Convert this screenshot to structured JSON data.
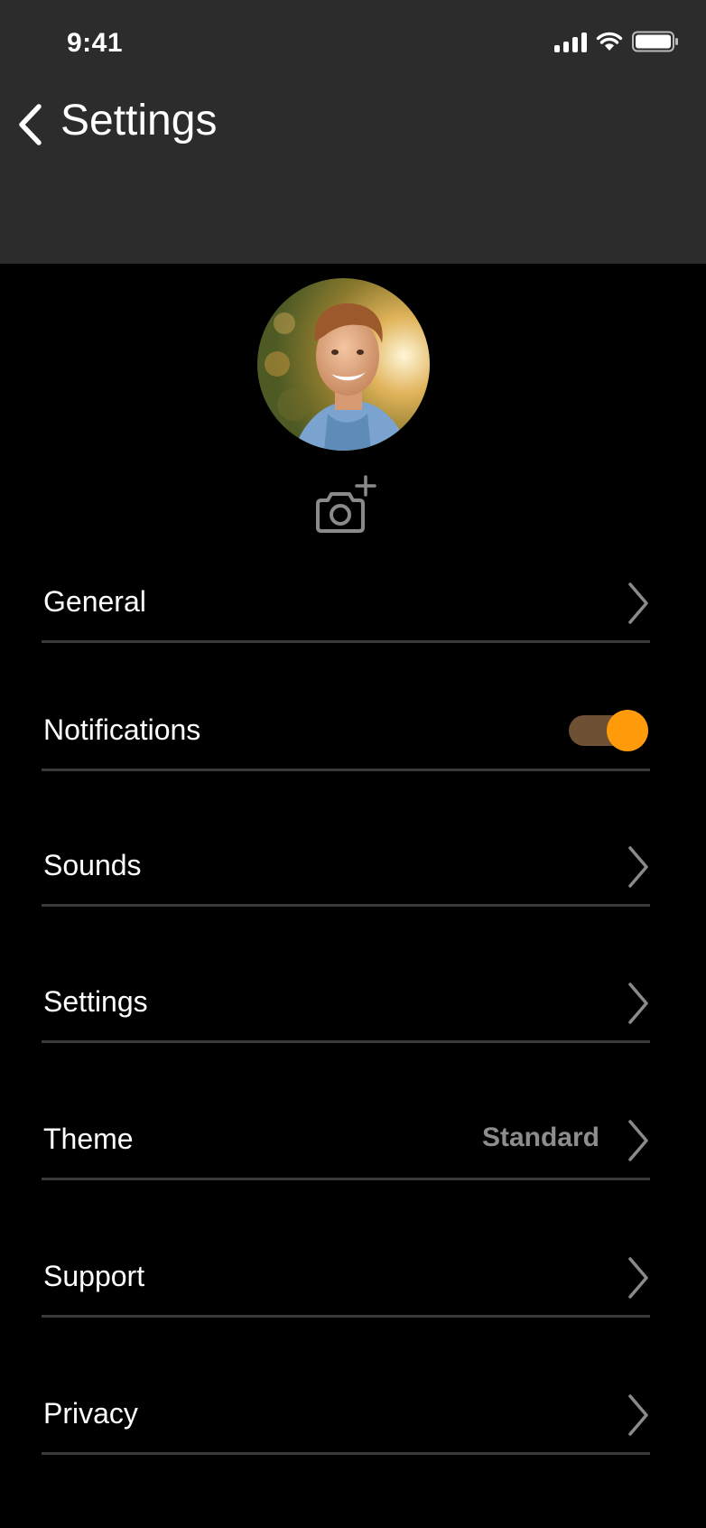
{
  "status_bar": {
    "time": "9:41"
  },
  "nav": {
    "title": "Settings",
    "back_icon": "chevron-left-icon"
  },
  "profile": {
    "avatar_alt": "profile photo",
    "camera_icon": "camera-add-icon"
  },
  "colors": {
    "header_bg": "#2c2c2c",
    "background": "#000000",
    "accent": "#ff9b0a",
    "divider": "#3a3a3a",
    "secondary_text": "#8d8d8d"
  },
  "menu": [
    {
      "label": "General",
      "accessory": "chevron"
    },
    {
      "label": "Notifications",
      "accessory": "toggle",
      "toggle_on": true
    },
    {
      "label": "Sounds",
      "accessory": "chevron"
    },
    {
      "label": "Settings",
      "accessory": "chevron"
    },
    {
      "label": "Theme",
      "accessory": "chevron",
      "value": "Standard"
    },
    {
      "label": "Support",
      "accessory": "chevron"
    },
    {
      "label": "Privacy",
      "accessory": "chevron"
    }
  ]
}
